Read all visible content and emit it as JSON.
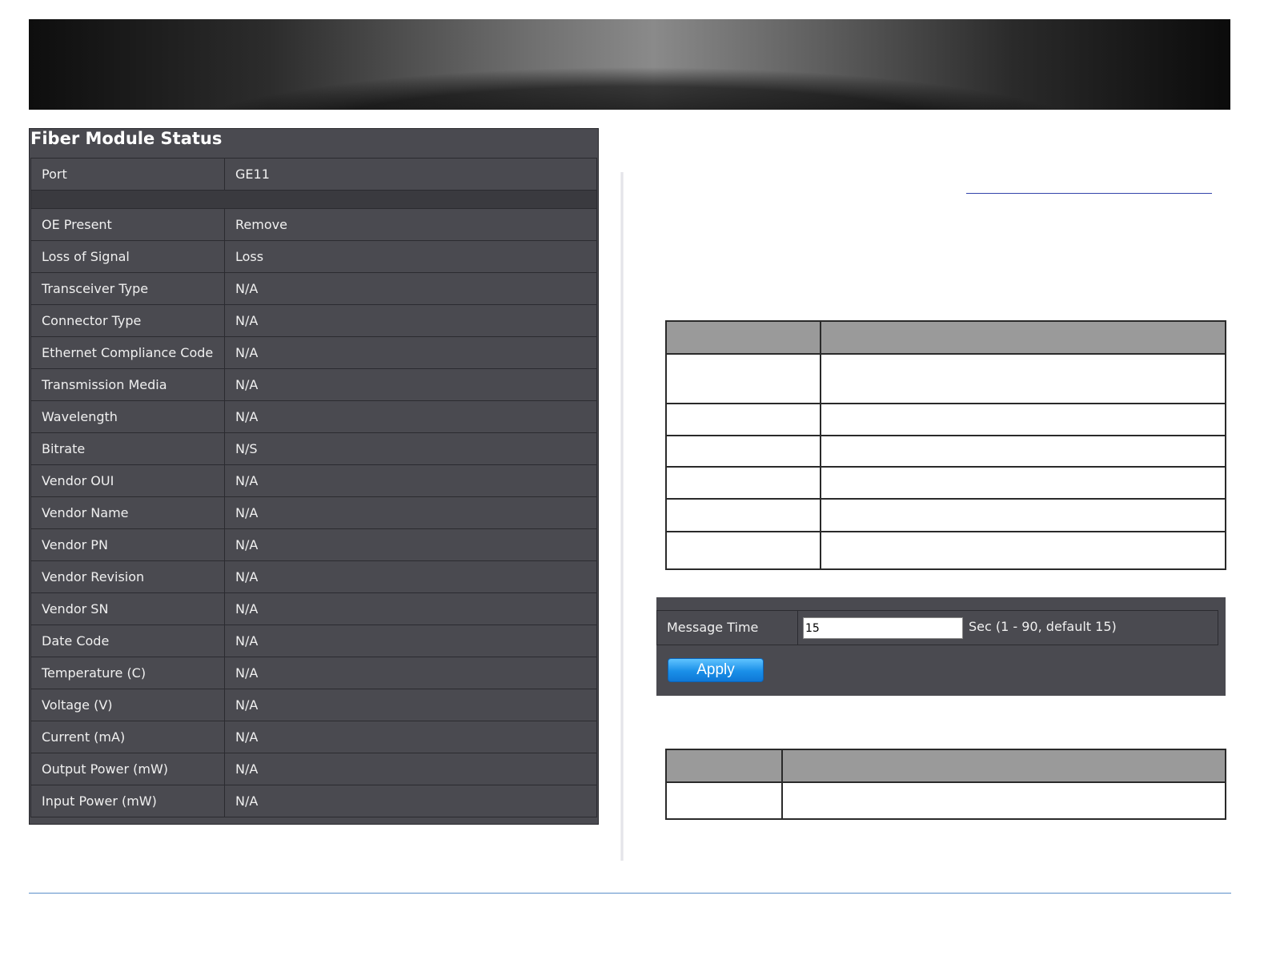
{
  "fiber_module_status": {
    "title": "Fiber Module Status",
    "port": {
      "label": "Port",
      "value": "GE11"
    },
    "rows": [
      {
        "label": "OE Present",
        "value": "Remove"
      },
      {
        "label": "Loss of Signal",
        "value": "Loss"
      },
      {
        "label": "Transceiver Type",
        "value": "N/A"
      },
      {
        "label": "Connector Type",
        "value": "N/A"
      },
      {
        "label": "Ethernet Compliance Code",
        "value": "N/A"
      },
      {
        "label": "Transmission Media",
        "value": "N/A"
      },
      {
        "label": "Wavelength",
        "value": "N/A"
      },
      {
        "label": "Bitrate",
        "value": "N/S"
      },
      {
        "label": "Vendor OUI",
        "value": "N/A"
      },
      {
        "label": "Vendor Name",
        "value": "N/A"
      },
      {
        "label": "Vendor PN",
        "value": "N/A"
      },
      {
        "label": "Vendor Revision",
        "value": "N/A"
      },
      {
        "label": "Vendor SN",
        "value": "N/A"
      },
      {
        "label": "Date Code",
        "value": "N/A"
      },
      {
        "label": "Temperature (C)",
        "value": "N/A"
      },
      {
        "label": "Voltage (V)",
        "value": "N/A"
      },
      {
        "label": "Current (mA)",
        "value": "N/A"
      },
      {
        "label": "Output Power (mW)",
        "value": "N/A"
      },
      {
        "label": "Input Power (mW)",
        "value": "N/A"
      }
    ]
  },
  "message_time": {
    "label": "Message Time",
    "value": "15",
    "hint": "Sec (1 - 90, default 15)",
    "apply_label": "Apply"
  }
}
